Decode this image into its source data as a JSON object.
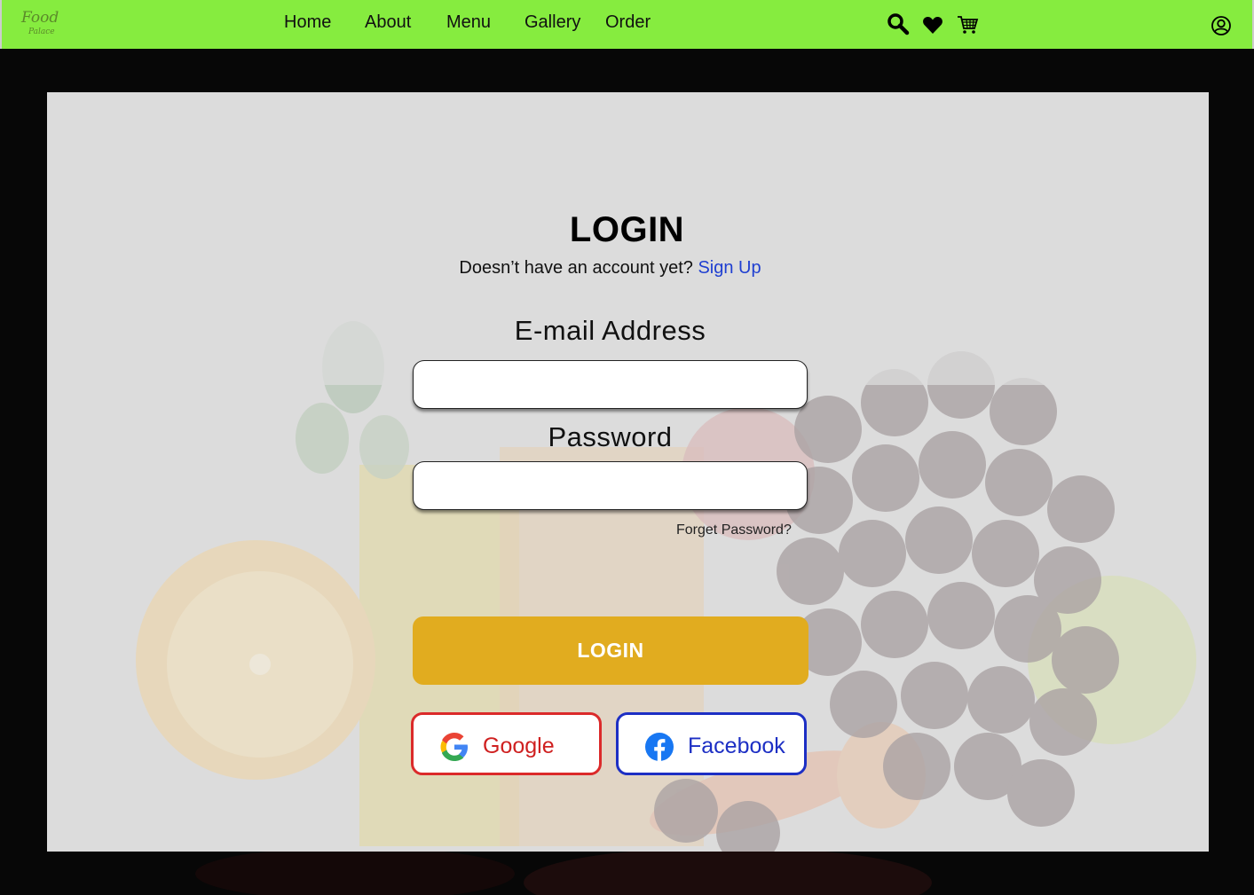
{
  "logo": {
    "line1": "Food",
    "line2": "Palace"
  },
  "nav": {
    "home": "Home",
    "about": "About",
    "menu": "Menu",
    "gallery": "Gallery",
    "order": "Order"
  },
  "icons": {
    "search": "search-icon",
    "favorites": "heart-icon",
    "cart": "cart-icon",
    "account": "user-circle-icon"
  },
  "login": {
    "title": "LOGIN",
    "prompt": "Doesn’t have an account yet?",
    "signup": "Sign Up",
    "email_label": "E-mail Address",
    "email_value": "",
    "password_label": "Password",
    "password_value": "",
    "forgot": "Forget Password?",
    "button": "LOGIN"
  },
  "social": {
    "google": "Google",
    "facebook": "Facebook"
  },
  "colors": {
    "nav_bg": "#86ec3f",
    "accent": "#e1ac1f",
    "google": "#db2a2a",
    "facebook": "#1d2fc4",
    "link": "#1f3fd1"
  }
}
